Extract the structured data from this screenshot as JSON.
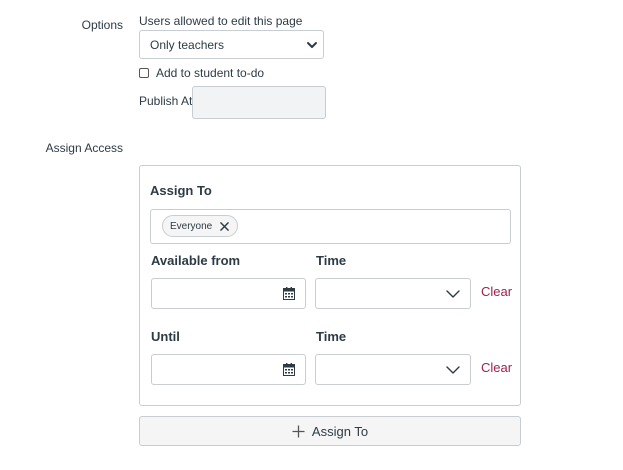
{
  "options": {
    "label": "Options",
    "edit_label": "Users allowed to edit this page",
    "edit_value": "Only teachers",
    "todo_label": "Add to student to-do",
    "publish_label": "Publish At",
    "publish_value": ""
  },
  "assign_access": {
    "label": "Assign Access",
    "assign_to_title": "Assign To",
    "assignees": [
      "Everyone"
    ],
    "available_from_label": "Available from",
    "available_time_label": "Time",
    "available_clear": "Clear",
    "until_label": "Until",
    "until_time_label": "Time",
    "until_clear": "Clear",
    "add_button_label": "Assign To"
  },
  "icons": {
    "select_arrow": "chevron-down-icon",
    "remove_pill": "close-icon",
    "calendar": "calendar-icon",
    "time_arrow": "chevron-down-icon",
    "add": "plus-icon"
  },
  "colors": {
    "text": "#2d3b45",
    "border": "#c7cdd1",
    "link": "#9c2249",
    "disabled_bg": "#f2f3f4",
    "button_bg": "#f5f5f5"
  }
}
